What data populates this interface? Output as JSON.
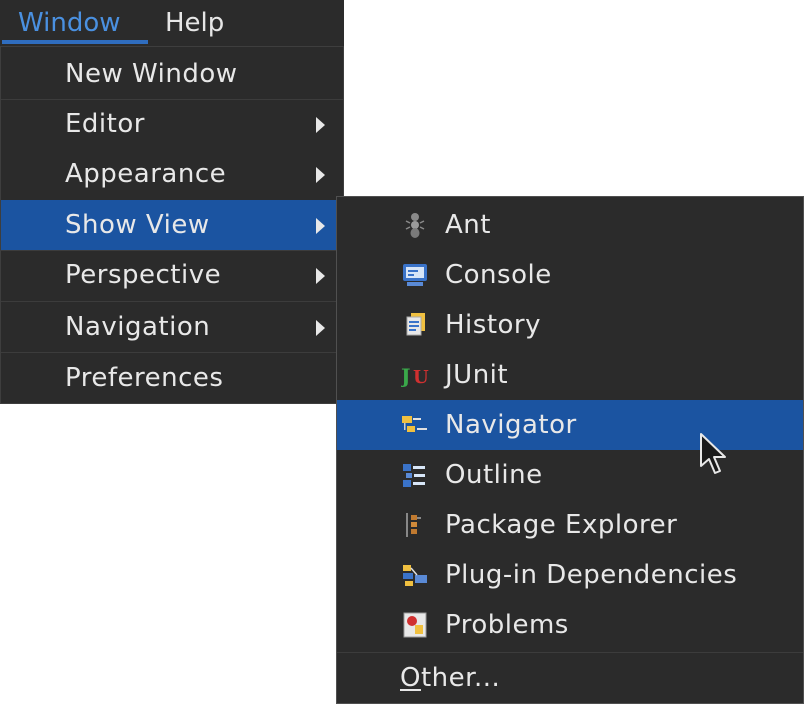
{
  "menubar": {
    "window_label": "Window",
    "help_label": "Help"
  },
  "window_menu": {
    "items": [
      {
        "label": "New Window",
        "has_submenu": false
      },
      {
        "label": "Editor",
        "has_submenu": true
      },
      {
        "label": "Appearance",
        "has_submenu": true
      },
      {
        "label": "Show View",
        "has_submenu": true,
        "selected": true
      },
      {
        "label": "Perspective",
        "has_submenu": true
      },
      {
        "label": "Navigation",
        "has_submenu": true
      },
      {
        "label": "Preferences",
        "has_submenu": false
      }
    ]
  },
  "show_view_menu": {
    "items": [
      {
        "label": "Ant",
        "icon": "ant-icon"
      },
      {
        "label": "Console",
        "icon": "console-icon"
      },
      {
        "label": "History",
        "icon": "history-icon"
      },
      {
        "label": "JUnit",
        "icon": "junit-icon"
      },
      {
        "label": "Navigator",
        "icon": "navigator-icon",
        "selected": true
      },
      {
        "label": "Outline",
        "icon": "outline-icon"
      },
      {
        "label": "Package Explorer",
        "icon": "package-explorer-icon"
      },
      {
        "label": "Plug-in Dependencies",
        "icon": "plugin-dependencies-icon"
      },
      {
        "label": "Problems",
        "icon": "problems-icon"
      }
    ],
    "other_label_mnemonic": "O",
    "other_label_rest": "ther..."
  },
  "colors": {
    "menu_bg": "#2b2b2b",
    "selection": "#1b54a1",
    "active_menubar_text": "#4a90e0"
  }
}
